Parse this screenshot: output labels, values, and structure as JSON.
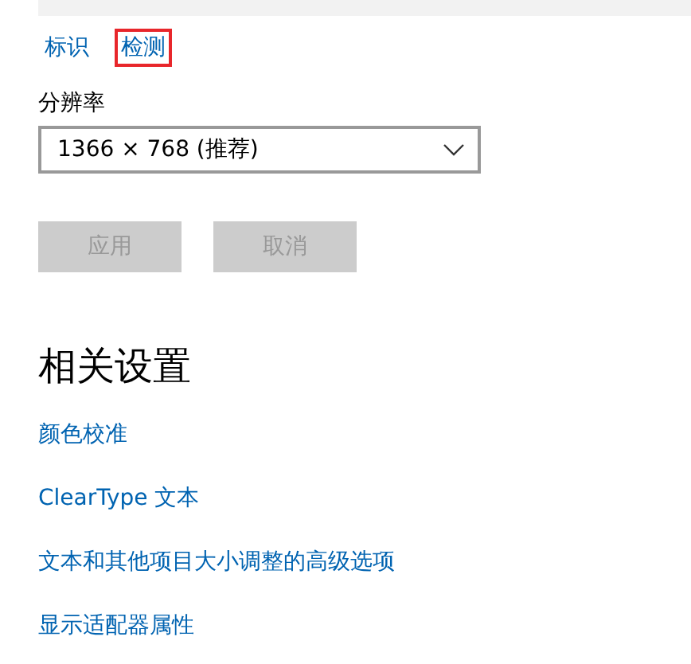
{
  "top_links": [
    {
      "label": "标识",
      "highlighted": false
    },
    {
      "label": "检测",
      "highlighted": true
    }
  ],
  "resolution": {
    "label": "分辨率",
    "value": "1366 × 768 (推荐)"
  },
  "buttons": [
    {
      "label": "应用",
      "disabled": true
    },
    {
      "label": "取消",
      "disabled": true
    }
  ],
  "related": {
    "title": "相关设置",
    "links": [
      "颜色校准",
      "ClearType 文本",
      "文本和其他项目大小调整的高级选项",
      "显示适配器属性"
    ]
  }
}
